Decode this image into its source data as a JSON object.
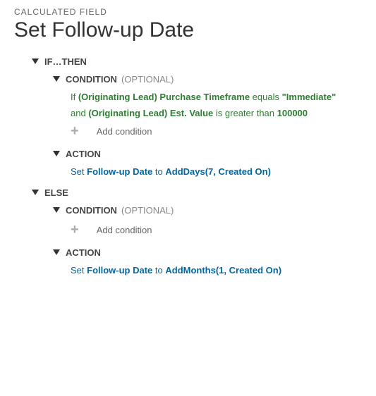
{
  "subtitle": "CALCULATED FIELD",
  "title": "Set Follow-up Date",
  "ifThen": {
    "label": "IF…THEN",
    "condition": {
      "label": "CONDITION",
      "optional": "(OPTIONAL)",
      "line1": {
        "prefix": "If ",
        "field": "(Originating Lead) Purchase Timeframe",
        "op": " equals ",
        "value": "\"Immediate\""
      },
      "line2": {
        "prefix": "and ",
        "field": "(Originating Lead) Est. Value",
        "op": " is greater than ",
        "value": "100000"
      },
      "addLabel": "Add condition"
    },
    "action": {
      "label": "ACTION",
      "line": {
        "prefix": "Set ",
        "field": "Follow-up Date",
        "mid": " to ",
        "func": "AddDays(7, Created On)"
      }
    }
  },
  "else": {
    "label": "ELSE",
    "condition": {
      "label": "CONDITION",
      "optional": "(OPTIONAL)",
      "addLabel": "Add condition"
    },
    "action": {
      "label": "ACTION",
      "line": {
        "prefix": "Set ",
        "field": "Follow-up Date",
        "mid": " to ",
        "func": "AddMonths(1, Created On)"
      }
    }
  }
}
